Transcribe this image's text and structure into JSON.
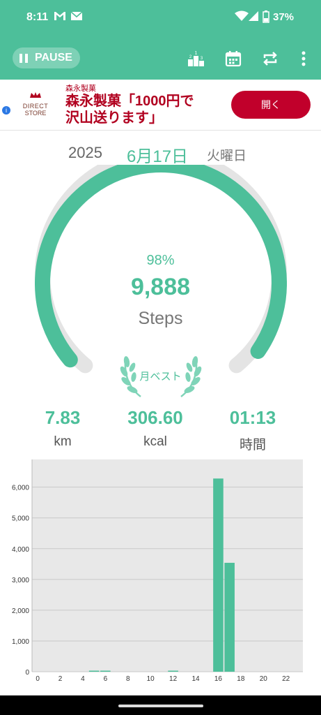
{
  "status_bar": {
    "time": "8:11",
    "battery": "37%"
  },
  "toolbar": {
    "pause_label": "PAUSE"
  },
  "ad": {
    "logo_line1": "DIRECT",
    "logo_line2": "STORE",
    "brand": "森永製菓",
    "headline_line1": "森永製菓「1000円で",
    "headline_line2": "沢山送ります」",
    "button": "開く"
  },
  "date": {
    "year": "2025",
    "month_day": "6月17日",
    "weekday": "火曜日"
  },
  "progress": {
    "percent_text": "98%",
    "percent": 98,
    "steps": "9,888",
    "steps_label": "Steps"
  },
  "badge": {
    "label": "月ベスト"
  },
  "stats": [
    {
      "value": "7.83",
      "label": "km"
    },
    {
      "value": "306.60",
      "label": "kcal"
    },
    {
      "value": "01:13",
      "label": "時間"
    }
  ],
  "colors": {
    "accent": "#4dbf9a",
    "ad_red": "#c1002b",
    "chart_bg": "#e8e8e8"
  },
  "chart_data": {
    "type": "bar",
    "x": [
      0,
      1,
      2,
      3,
      4,
      5,
      6,
      7,
      8,
      9,
      10,
      11,
      12,
      13,
      14,
      15,
      16,
      17,
      18,
      19,
      20,
      21,
      22,
      23
    ],
    "values": [
      0,
      0,
      0,
      0,
      0,
      12,
      20,
      0,
      0,
      0,
      0,
      0,
      18,
      0,
      0,
      0,
      6280,
      3540,
      0,
      0,
      0,
      0,
      0,
      0
    ],
    "xticks": [
      "0",
      "2",
      "4",
      "6",
      "8",
      "10",
      "12",
      "14",
      "16",
      "18",
      "20",
      "22"
    ],
    "yticks": [
      "0",
      "1,000",
      "2,000",
      "3,000",
      "4,000",
      "5,000",
      "6,000"
    ],
    "ylim": [
      0,
      6900
    ],
    "grid": true
  }
}
